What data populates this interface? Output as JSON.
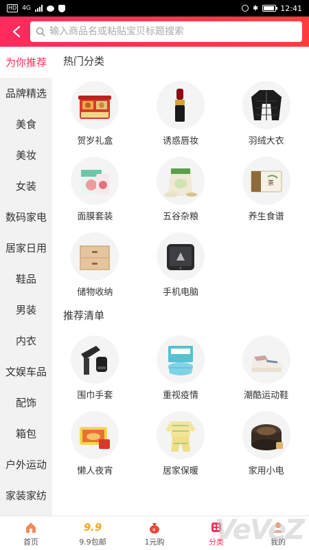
{
  "status_bar": {
    "badge": "HD",
    "network": "4G",
    "time": "12:41",
    "battery_level": 0.9
  },
  "search": {
    "placeholder": "输入商品名或粘贴宝贝标题搜索"
  },
  "sidebar": {
    "items": [
      {
        "label": "为你推荐",
        "active": true
      },
      {
        "label": "品牌精选",
        "active": false
      },
      {
        "label": "美食",
        "active": false
      },
      {
        "label": "美妆",
        "active": false
      },
      {
        "label": "女装",
        "active": false
      },
      {
        "label": "数码家电",
        "active": false
      },
      {
        "label": "居家日用",
        "active": false
      },
      {
        "label": "鞋品",
        "active": false
      },
      {
        "label": "男装",
        "active": false
      },
      {
        "label": "内衣",
        "active": false
      },
      {
        "label": "文娱车品",
        "active": false
      },
      {
        "label": "配饰",
        "active": false
      },
      {
        "label": "箱包",
        "active": false
      },
      {
        "label": "户外运动",
        "active": false
      },
      {
        "label": "家装家纺",
        "active": false
      }
    ]
  },
  "sections": [
    {
      "title": "热门分类",
      "items": [
        {
          "label": "贺岁礼盒",
          "icon": "gift-box-icon"
        },
        {
          "label": "诱惑唇妆",
          "icon": "lipstick-icon"
        },
        {
          "label": "羽绒大衣",
          "icon": "down-jacket-icon"
        },
        {
          "label": "面膜套装",
          "icon": "face-mask-icon"
        },
        {
          "label": "五谷杂粮",
          "icon": "grain-bag-icon"
        },
        {
          "label": "养生食谱",
          "icon": "tea-box-icon"
        },
        {
          "label": "储物收纳",
          "icon": "storage-drawer-icon"
        },
        {
          "label": "手机电脑",
          "icon": "phone-icon"
        }
      ]
    },
    {
      "title": "推荐清单",
      "items": [
        {
          "label": "围巾手套",
          "icon": "scarf-gloves-icon"
        },
        {
          "label": "重视疫情",
          "icon": "medical-mask-icon"
        },
        {
          "label": "潮酷运动鞋",
          "icon": "sneaker-icon"
        },
        {
          "label": "懒人夜宵",
          "icon": "instant-noodle-icon"
        },
        {
          "label": "居家保暖",
          "icon": "pajamas-icon"
        },
        {
          "label": "家用小电",
          "icon": "rice-cooker-icon"
        }
      ]
    }
  ],
  "tabbar": {
    "items": [
      {
        "label": "首页",
        "icon": "home-icon",
        "active": false
      },
      {
        "label": "9.9包邮",
        "icon": "nine-nine-icon",
        "icon_text": "9.9",
        "active": false
      },
      {
        "label": "1元购",
        "icon": "money-bag-icon",
        "active": false
      },
      {
        "label": "分类",
        "icon": "category-icon",
        "active": true
      },
      {
        "label": "我的",
        "icon": "profile-icon",
        "active": false
      }
    ]
  },
  "watermark": "VeVeZ",
  "colors": {
    "accent": "#ff2e5a",
    "header_start": "#ff2b5e",
    "header_end": "#ff3d3d",
    "sidebar_bg": "#f2f2f2"
  }
}
